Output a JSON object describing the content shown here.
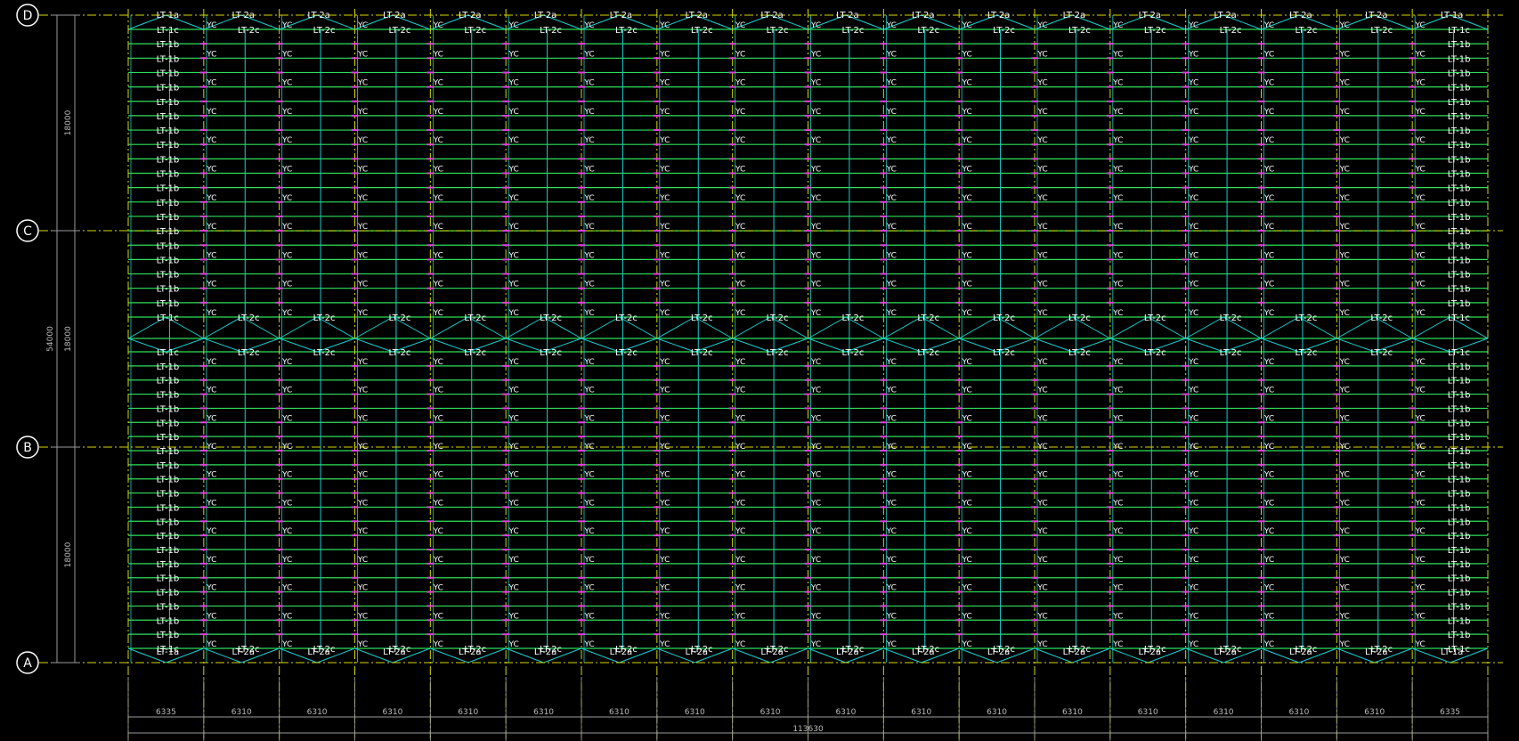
{
  "drawing": {
    "background": "#000000",
    "colors": {
      "purlin": "#2ee05a",
      "brace": "#16d0d0",
      "gridline": "#d8d800",
      "tag": "#e040e0",
      "dimension": "#9a9a9a",
      "text": "#ffffff"
    }
  },
  "grid": {
    "axes": [
      "D",
      "C",
      "B",
      "A"
    ],
    "bays_count": 18,
    "bay_spans": [
      "6335",
      "6310",
      "6310",
      "6310",
      "6310",
      "6310",
      "6310",
      "6310",
      "6310",
      "6310",
      "6310",
      "6310",
      "6310",
      "6310",
      "6310",
      "6310",
      "6310",
      "6335"
    ],
    "total_span": "113630",
    "vertical_dims": {
      "total": "54000",
      "segments": [
        "18000",
        "18000",
        "18000"
      ]
    }
  },
  "labels": {
    "bay_tag": "YC",
    "edge_a": "LT-1a",
    "edge_b": "LT-1b",
    "edge_c": "LT-1c",
    "mid_a": "LT-2a",
    "mid_c": "LT-2c"
  }
}
